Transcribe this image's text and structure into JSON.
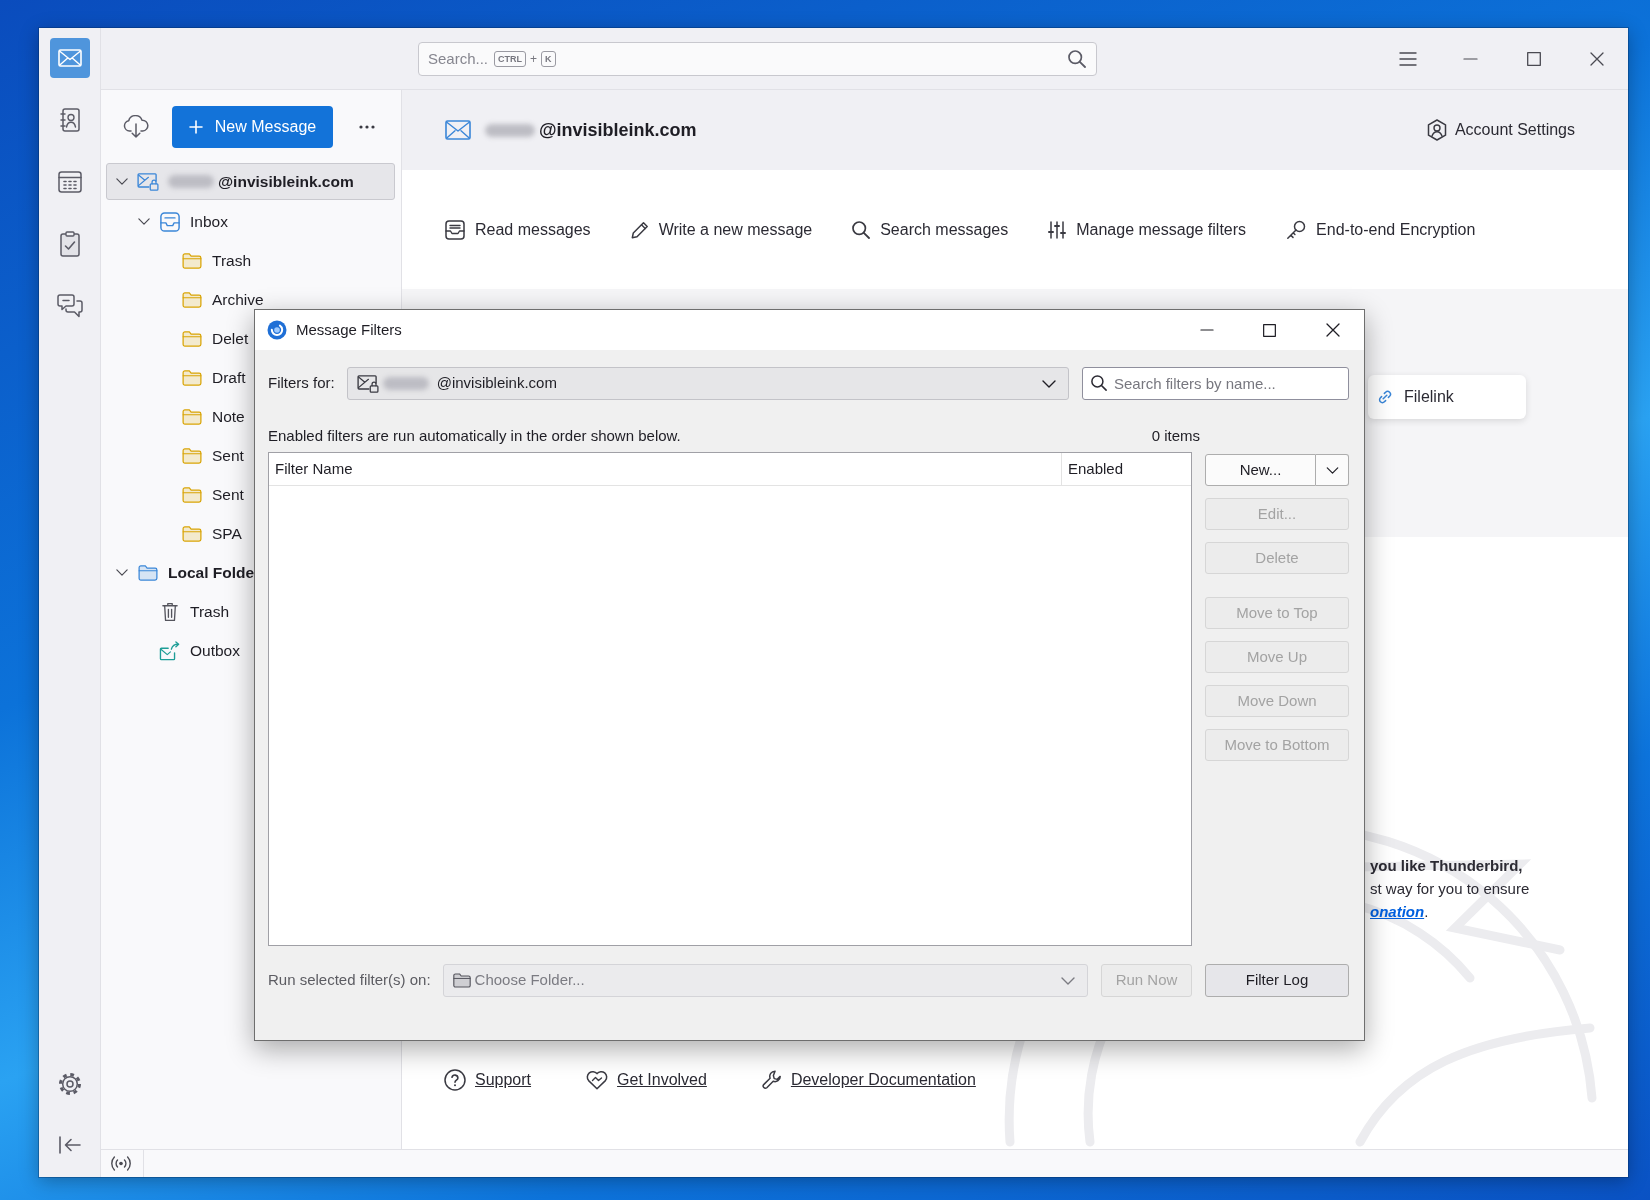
{
  "spaces": [
    {
      "kind": "mail",
      "selected": true
    },
    {
      "kind": "address_book",
      "selected": false
    },
    {
      "kind": "calendar",
      "selected": false
    },
    {
      "kind": "tasks",
      "selected": false
    },
    {
      "kind": "chat",
      "selected": false
    }
  ],
  "title_bar": {
    "search": {
      "placeholder": "Search...",
      "shortcut_keys": [
        "CTRL",
        "K"
      ],
      "key_joiner": "+"
    }
  },
  "folder_pane": {
    "new_message_button": {
      "label": "New Message"
    },
    "tree": [
      {
        "name": "@invisibleink.com",
        "kind": "account",
        "redacted_prefix": true,
        "selected": true,
        "expanded": true,
        "children": [
          {
            "name": "Inbox",
            "kind": "inbox",
            "selected": false,
            "expanded": true,
            "children": [
              {
                "name": "Trash",
                "kind": "folder",
                "selected": false
              },
              {
                "name": "Archive",
                "kind": "folder",
                "selected": false
              },
              {
                "name": "Delet",
                "kind": "folder",
                "selected": false
              },
              {
                "name": "Draft",
                "kind": "folder",
                "selected": false
              },
              {
                "name": "Note",
                "kind": "folder",
                "selected": false
              },
              {
                "name": "Sent",
                "kind": "folder",
                "selected": false
              },
              {
                "name": "Sent",
                "kind": "folder",
                "selected": false
              },
              {
                "name": "SPA",
                "kind": "folder",
                "selected": false
              }
            ]
          }
        ]
      },
      {
        "name": "Local Folde",
        "kind": "local",
        "selected": false,
        "expanded": true,
        "children": [
          {
            "name": "Trash",
            "kind": "trash",
            "selected": false
          },
          {
            "name": "Outbox",
            "kind": "outbox",
            "selected": false
          }
        ]
      }
    ]
  },
  "main_pane": {
    "header": {
      "email": "@invisibleink.com",
      "redacted_prefix": true,
      "settings_link": "Account Settings"
    },
    "actions": [
      {
        "kind": "read",
        "label": "Read messages"
      },
      {
        "kind": "write",
        "label": "Write a new message"
      },
      {
        "kind": "search",
        "label": "Search messages"
      },
      {
        "kind": "filters",
        "label": "Manage message filters"
      },
      {
        "kind": "encryption",
        "label": "End-to-end Encryption"
      }
    ],
    "setup_cards": [
      {
        "label": "Filelink"
      }
    ],
    "donation": {
      "heading": "you like Thunderbird,",
      "text": "st way for you to ensure",
      "link": "onation",
      "link_suffix": "."
    },
    "footer_links": [
      {
        "kind": "support",
        "label": "Support"
      },
      {
        "kind": "involved",
        "label": "Get Involved"
      },
      {
        "kind": "docs",
        "label": "Developer Documentation"
      }
    ]
  },
  "dialog": {
    "title": "Message Filters",
    "filters_for": {
      "label": "Filters for:",
      "account": "@invisibleink.com",
      "redacted_prefix": true
    },
    "search": {
      "placeholder": "Search filters by name..."
    },
    "info": "Enabled filters are run automatically in the order shown below.",
    "count": "0 items",
    "table": {
      "columns": [
        "Filter Name",
        "Enabled"
      ]
    },
    "button_groups": [
      {
        "buttons": [
          {
            "kind": "split",
            "label": "New...",
            "disabled": false
          },
          {
            "kind": "plain",
            "label": "Edit...",
            "disabled": true
          },
          {
            "kind": "plain",
            "label": "Delete",
            "disabled": true
          }
        ]
      },
      {
        "buttons": [
          {
            "kind": "plain",
            "label": "Move to Top",
            "disabled": true
          },
          {
            "kind": "plain",
            "label": "Move Up",
            "disabled": true
          },
          {
            "kind": "plain",
            "label": "Move Down",
            "disabled": true
          },
          {
            "kind": "plain",
            "label": "Move to Bottom",
            "disabled": true
          }
        ]
      }
    ],
    "run_row": {
      "label": "Run selected filter(s) on:",
      "disabled": true,
      "folder_select": {
        "label": "Choose Folder...",
        "disabled": true
      },
      "run_button": {
        "label": "Run Now",
        "disabled": true
      },
      "log_button": {
        "label": "Filter Log",
        "disabled": false
      }
    }
  }
}
